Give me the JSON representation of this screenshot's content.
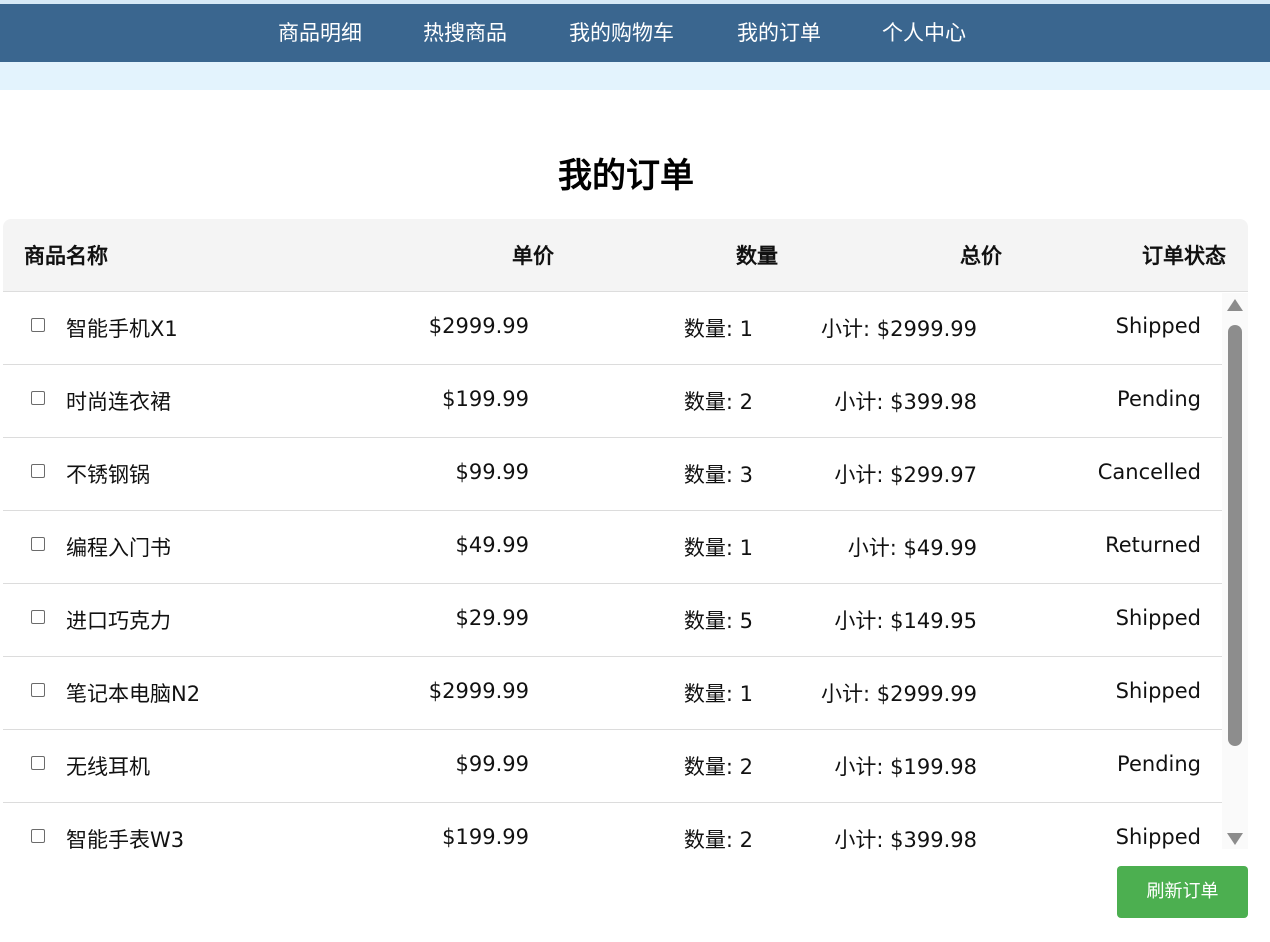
{
  "nav": {
    "items": [
      "商品明细",
      "热搜商品",
      "我的购物车",
      "我的订单",
      "个人中心"
    ]
  },
  "page": {
    "title": "我的订单"
  },
  "table": {
    "headers": {
      "name": "商品名称",
      "price": "单价",
      "qty": "数量",
      "total": "总价",
      "status": "订单状态"
    },
    "rows": [
      {
        "name": "智能手机X1",
        "price": "$2999.99",
        "qty": "数量: 1",
        "subtotal": "小计: $2999.99",
        "status": "Shipped"
      },
      {
        "name": "时尚连衣裙",
        "price": "$199.99",
        "qty": "数量: 2",
        "subtotal": "小计: $399.98",
        "status": "Pending"
      },
      {
        "name": "不锈钢锅",
        "price": "$99.99",
        "qty": "数量: 3",
        "subtotal": "小计: $299.97",
        "status": "Cancelled"
      },
      {
        "name": "编程入门书",
        "price": "$49.99",
        "qty": "数量: 1",
        "subtotal": "小计: $49.99",
        "status": "Returned"
      },
      {
        "name": "进口巧克力",
        "price": "$29.99",
        "qty": "数量: 5",
        "subtotal": "小计: $149.95",
        "status": "Shipped"
      },
      {
        "name": "笔记本电脑N2",
        "price": "$2999.99",
        "qty": "数量: 1",
        "subtotal": "小计: $2999.99",
        "status": "Shipped"
      },
      {
        "name": "无线耳机",
        "price": "$99.99",
        "qty": "数量: 2",
        "subtotal": "小计: $199.98",
        "status": "Pending"
      },
      {
        "name": "智能手表W3",
        "price": "$199.99",
        "qty": "数量: 2",
        "subtotal": "小计: $399.98",
        "status": "Shipped"
      }
    ]
  },
  "actions": {
    "refresh_label": "刷新订单"
  },
  "colors": {
    "nav_bg": "#3a668f",
    "subbar_bg": "#e3f3fd",
    "header_bg": "#f4f4f4",
    "refresh_bg": "#4caf50",
    "scrollbar_thumb": "#8d8d8d"
  },
  "icons": {
    "scroll_up": "triangle-up-icon",
    "scroll_down": "triangle-down-icon",
    "row_select": "checkbox"
  }
}
